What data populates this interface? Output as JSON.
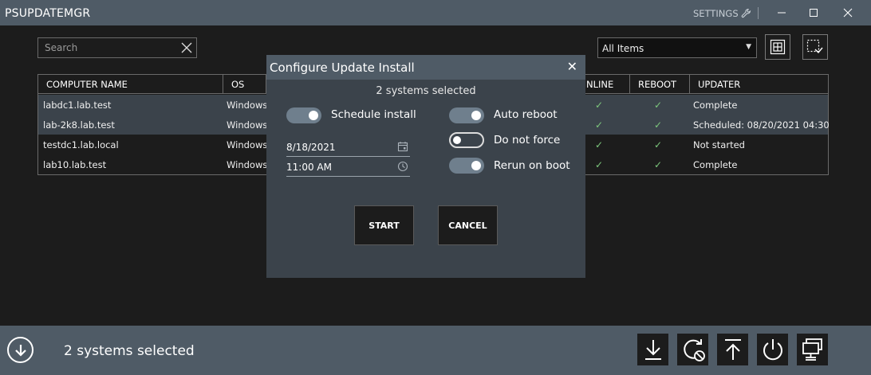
{
  "app": {
    "title": "PSUPDATEMGR",
    "settings_label": "SETTINGS"
  },
  "toolbar": {
    "search_placeholder": "Search",
    "filter_value": "All Items"
  },
  "table": {
    "columns": [
      "COMPUTER NAME",
      "OS",
      "ONLINE",
      "REBOOT",
      "UPDATER"
    ],
    "visible_online_header": "NLINE",
    "rows": [
      {
        "name": "labdc1.lab.test",
        "os": "Windows",
        "online": "✓",
        "reboot": "✓",
        "updater": "Complete"
      },
      {
        "name": "lab-2k8.lab.test",
        "os": "Windows",
        "online": "✓",
        "reboot": "✓",
        "updater": "Scheduled: 08/20/2021 04:30"
      },
      {
        "name": "testdc1.lab.local",
        "os": "Windows",
        "online": "✓",
        "reboot": "✓",
        "updater": "Not started"
      },
      {
        "name": "lab10.lab.test",
        "os": "Windows",
        "online": "✓",
        "reboot": "✓",
        "updater": "Complete"
      }
    ]
  },
  "modal": {
    "title": "Configure Update Install",
    "subtitle": "2 systems selected",
    "schedule_label": "Schedule install",
    "schedule_on": true,
    "date_value": "8/18/2021",
    "time_value": "11:00 AM",
    "auto_reboot_label": "Auto reboot",
    "auto_reboot_on": true,
    "do_not_force_label": "Do not force",
    "do_not_force_on": false,
    "rerun_label": "Rerun on boot",
    "rerun_on": true,
    "start_label": "START",
    "cancel_label": "CANCEL"
  },
  "footer": {
    "status": "2 systems selected",
    "actions": [
      "download-icon",
      "reboot-check-icon",
      "upload-icon",
      "power-icon",
      "network-icon"
    ]
  },
  "colors": {
    "chrome": "#4f5b66",
    "background": "#1c1c1c",
    "modal": "#3b434b",
    "check": "#7dc87d",
    "selected_row": "#3b434b"
  }
}
